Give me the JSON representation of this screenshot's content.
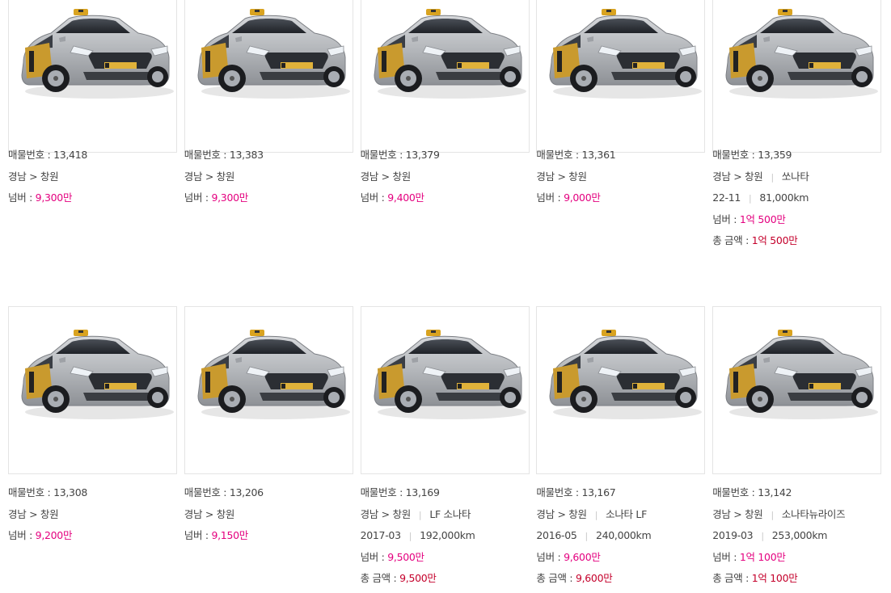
{
  "listings": [
    {
      "id_label": "매물번호 : ",
      "id": "13,418",
      "region": "경남 > 창원",
      "model": "",
      "year": "",
      "mileage": "",
      "price_label": "넘버 : ",
      "price": "9,300만",
      "total_label": "",
      "total": ""
    },
    {
      "id_label": "매물번호 : ",
      "id": "13,383",
      "region": "경남 > 창원",
      "model": "",
      "year": "",
      "mileage": "",
      "price_label": "넘버 : ",
      "price": "9,300만",
      "total_label": "",
      "total": ""
    },
    {
      "id_label": "매물번호 : ",
      "id": "13,379",
      "region": "경남 > 창원",
      "model": "",
      "year": "",
      "mileage": "",
      "price_label": "넘버 : ",
      "price": "9,400만",
      "total_label": "",
      "total": ""
    },
    {
      "id_label": "매물번호 : ",
      "id": "13,361",
      "region": "경남 > 창원",
      "model": "",
      "year": "",
      "mileage": "",
      "price_label": "넘버 : ",
      "price": "9,000만",
      "total_label": "",
      "total": ""
    },
    {
      "id_label": "매물번호 : ",
      "id": "13,359",
      "region": "경남 > 창원",
      "model": "쏘나타",
      "year": "22-11",
      "mileage": "81,000km",
      "price_label": "넘버 : ",
      "price": "1억 500만",
      "total_label": "총 금액 : ",
      "total": "1억 500만"
    },
    {
      "id_label": "매물번호 : ",
      "id": "13,308",
      "region": "경남 > 창원",
      "model": "",
      "year": "",
      "mileage": "",
      "price_label": "넘버 : ",
      "price": "9,200만",
      "total_label": "",
      "total": ""
    },
    {
      "id_label": "매물번호 : ",
      "id": "13,206",
      "region": "경남 > 창원",
      "model": "",
      "year": "",
      "mileage": "",
      "price_label": "넘버 : ",
      "price": "9,150만",
      "total_label": "",
      "total": ""
    },
    {
      "id_label": "매물번호 : ",
      "id": "13,169",
      "region": "경남 > 창원",
      "model": "LF 소나타",
      "year": "2017-03",
      "mileage": "192,000km",
      "price_label": "넘버 : ",
      "price": "9,500만",
      "total_label": "총 금액 : ",
      "total": "9,500만"
    },
    {
      "id_label": "매물번호 : ",
      "id": "13,167",
      "region": "경남 > 창원",
      "model": "소나타 LF",
      "year": "2016-05",
      "mileage": "240,000km",
      "price_label": "넘버 : ",
      "price": "9,600만",
      "total_label": "총 금액 : ",
      "total": "9,600만"
    },
    {
      "id_label": "매물번호 : ",
      "id": "13,142",
      "region": "경남 > 창원",
      "model": "소나타뉴라이즈",
      "year": "2019-03",
      "mileage": "253,000km",
      "price_label": "넘버 : ",
      "price": "1억 100만",
      "total_label": "총 금액 : ",
      "total": "1억 100만"
    }
  ],
  "car_image": {
    "icon": "taxi-car-photo",
    "body_color": "#b8babd",
    "roof_sign_color": "#d9a320",
    "door_decal_color": "#c99a2e"
  },
  "colors": {
    "price": "#e4007f",
    "total": "#c4002b",
    "text": "#444444",
    "border": "#e4e4e4"
  }
}
